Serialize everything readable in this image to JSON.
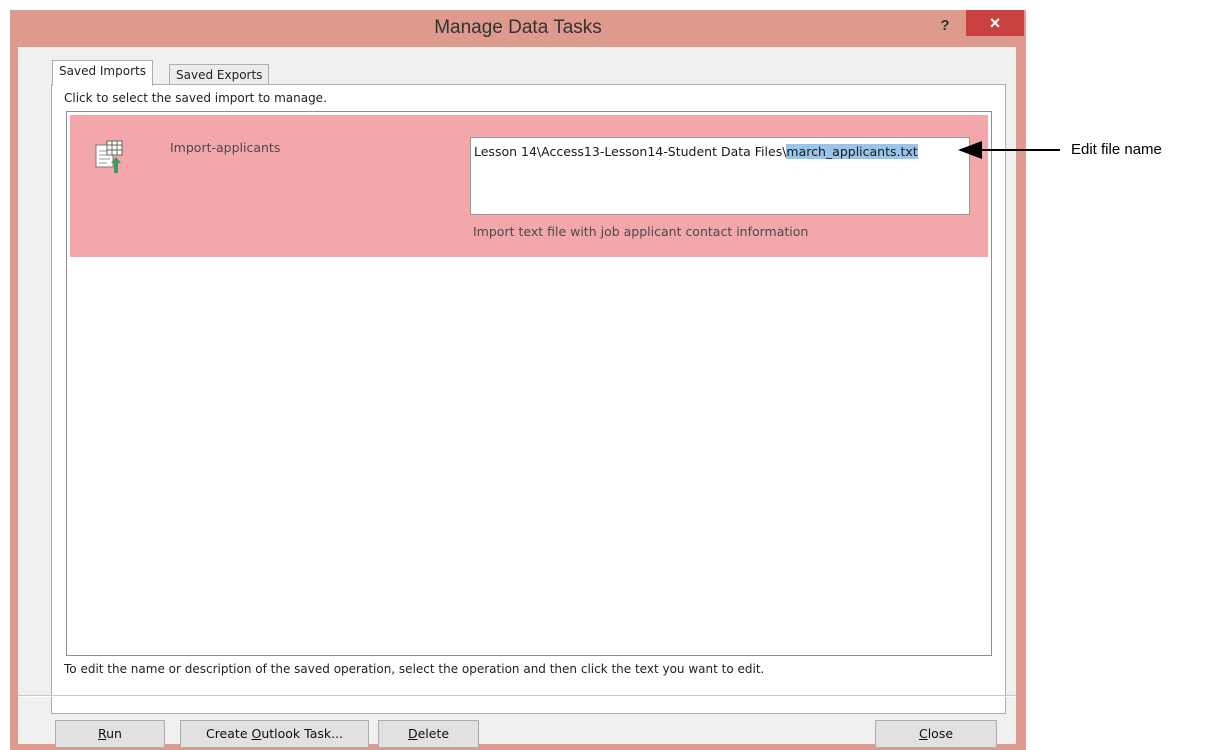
{
  "dialog": {
    "title": "Manage Data Tasks",
    "help_label": "?",
    "close_x_label": "×"
  },
  "tabs": [
    {
      "label": "Saved Imports",
      "selected": true
    },
    {
      "label": "Saved Exports",
      "selected": false
    }
  ],
  "panel": {
    "instruction_top": "Click to select the saved import to manage.",
    "instruction_bottom": "To edit the name or description of the saved operation, select the operation and then click the text you want to edit.",
    "operations": [
      {
        "name": "Import-applicants",
        "path_prefix": "Lesson 14\\Access13-Lesson14-Student Data Files\\",
        "path_selected": "march_applicants.txt",
        "description": "Import text file with job applicant contact information",
        "icon": "import-text-icon"
      }
    ]
  },
  "buttons": {
    "run": {
      "hotkey": "R",
      "rest": "un"
    },
    "outlook_task": {
      "before": "Create ",
      "hotkey": "O",
      "rest": "utlook Task..."
    },
    "delete": {
      "hotkey": "D",
      "rest": "elete"
    },
    "close": {
      "hotkey": "C",
      "rest": "lose"
    }
  },
  "callout": {
    "label": "Edit file name"
  },
  "colors": {
    "frame": "#de9a8c",
    "selected_row": "#f4a7aa",
    "text_selection": "#99c4ec",
    "close_button": "#c9423f"
  }
}
